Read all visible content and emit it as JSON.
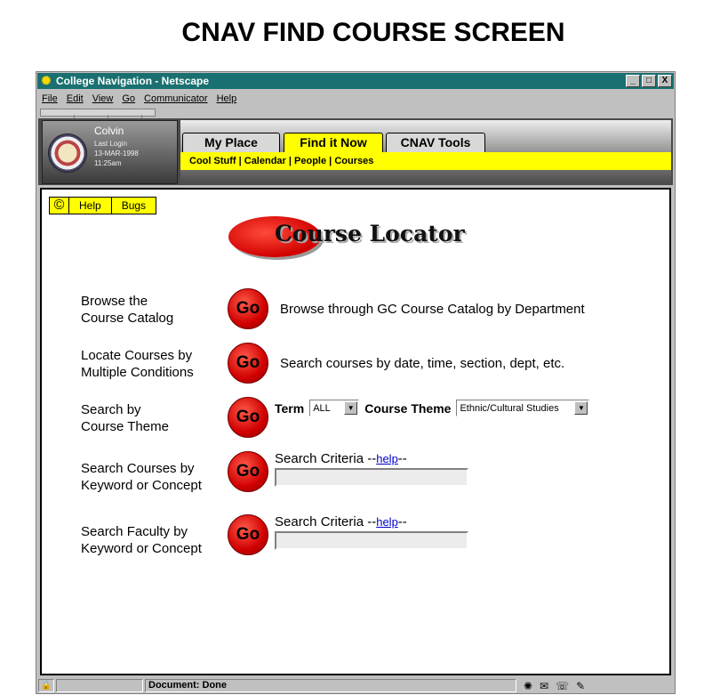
{
  "slide_title": "CNAV FIND COURSE SCREEN",
  "window": {
    "title": "College Navigation - Netscape",
    "buttons": [
      "_",
      "□",
      "X"
    ]
  },
  "menu": [
    "File",
    "Edit",
    "View",
    "Go",
    "Communicator",
    "Help"
  ],
  "user": {
    "name": "Colvin",
    "last_login_label": "Last Login",
    "last_login_date": "13-MAR-1998",
    "last_login_time": "11:25am"
  },
  "tabs": [
    {
      "label": "My Place",
      "active": false
    },
    {
      "label": "Find it Now",
      "active": true
    },
    {
      "label": "CNAV Tools",
      "active": false
    }
  ],
  "subnav": [
    "Cool Stuff",
    "Calendar",
    "People",
    "Courses"
  ],
  "helpbar": {
    "copyright": "©",
    "help": "Help",
    "bugs": "Bugs"
  },
  "logo_text": "Course Locator",
  "go_label": "Go",
  "rows": {
    "browse": {
      "label1": "Browse the",
      "label2": "Course Catalog",
      "desc": "Browse through GC Course Catalog by Department"
    },
    "locate": {
      "label1": "Locate Courses by",
      "label2": "Multiple Conditions",
      "desc": "Search courses by date, time, section, dept, etc."
    },
    "theme": {
      "label1": "Search by",
      "label2": "Course Theme",
      "term_label": "Term",
      "term_value": "ALL",
      "theme_label": "Course Theme",
      "theme_value": "Ethnic/Cultural Studies"
    },
    "keyword": {
      "label1": "Search Courses by",
      "label2": "Keyword or Concept",
      "criteria_label": "Search Criteria",
      "help_link": "help",
      "value": ""
    },
    "faculty": {
      "label1": "Search Faculty by",
      "label2": "Keyword or Concept",
      "criteria_label": "Search Criteria",
      "help_link": "help",
      "value": ""
    }
  },
  "status": {
    "text": "Document: Done"
  },
  "colors": {
    "titlebar": "#1a7070",
    "accent_yellow": "#ffff00",
    "go_red": "#d00000",
    "link_blue": "#0000cc"
  }
}
